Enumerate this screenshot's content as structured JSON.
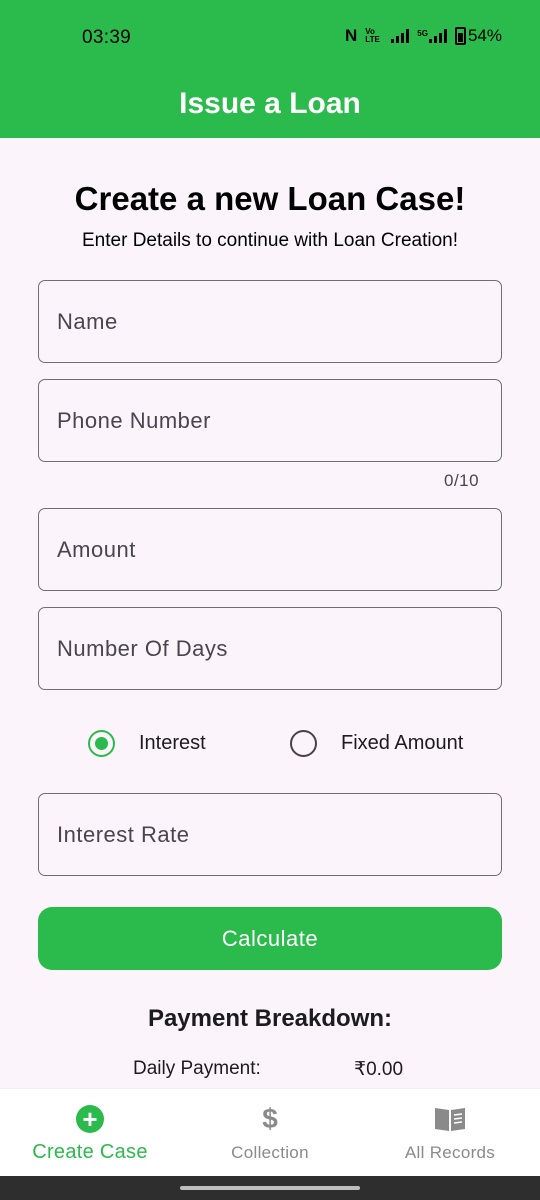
{
  "status_bar": {
    "time": "03:39",
    "nfc_symbol": "N",
    "volte_label": "Vo LTE",
    "network_label": "5G",
    "battery": "54%"
  },
  "app_bar": {
    "title": "Issue a Loan"
  },
  "form": {
    "headline": "Create a new Loan Case!",
    "subheadline": "Enter Details to continue with Loan Creation!",
    "name_placeholder": "Name",
    "phone_placeholder": "Phone Number",
    "phone_counter": "0/10",
    "amount_placeholder": "Amount",
    "days_placeholder": "Number Of Days",
    "radio_options": [
      {
        "label": "Interest",
        "selected": true
      },
      {
        "label": "Fixed Amount",
        "selected": false
      }
    ],
    "interest_rate_placeholder": "Interest Rate",
    "calculate_label": "Calculate"
  },
  "breakdown": {
    "title": "Payment Breakdown:",
    "daily_payment_label": "Daily Payment:",
    "daily_payment_value": "₹0.00"
  },
  "bottom_nav": {
    "items": [
      {
        "label": "Create Case",
        "icon": "add-circle-icon",
        "active": true
      },
      {
        "label": "Collection",
        "icon": "dollar-icon",
        "active": false
      },
      {
        "label": "All Records",
        "icon": "book-icon",
        "active": false
      }
    ]
  },
  "colors": {
    "primary": "#2bbb4c",
    "background": "#fbf5fb",
    "outline": "#6f6f73",
    "inactive_nav": "#8a8a8a"
  }
}
